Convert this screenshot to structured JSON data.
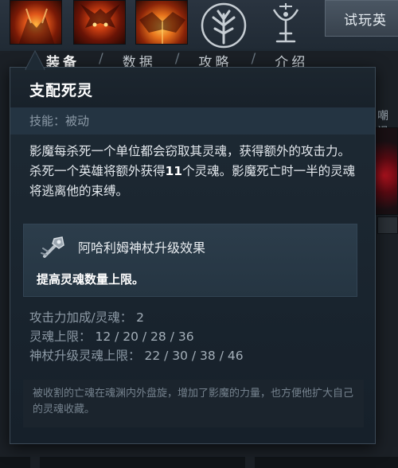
{
  "header": {
    "try_button_label": "试玩英"
  },
  "tabs": [
    {
      "label": "装备"
    },
    {
      "label": "数据"
    },
    {
      "label": "攻略"
    },
    {
      "label": "介绍"
    }
  ],
  "side": {
    "partial_text": "嘲讽"
  },
  "tooltip": {
    "ability_name": "支配死灵",
    "ability_type": "技能：被动",
    "description_part1": "影魔每杀死一个单位都会窃取其灵魂，获得额外的攻击力。杀死一个英雄将额外获得",
    "description_highlight": "11",
    "description_part2": "个灵魂。影魔死亡时一半的灵魂将逃离他的束缚。",
    "scepter_title": "阿哈利姆神杖升级效果",
    "scepter_description": "提高灵魂数量上限。",
    "stats": [
      {
        "label": "攻击力加成/灵魂：",
        "value": "2"
      },
      {
        "label": "灵魂上限：",
        "value": "12 / 20 / 28 / 36"
      },
      {
        "label": "神杖升级灵魂上限：",
        "value": "22 / 30 / 38 / 46"
      }
    ],
    "lore": "被收割的亡魂在魂渊内外盘旋，增加了影魔的力量，也方便他扩大自己的灵魂收藏。"
  },
  "icons": {
    "hero_portraits": [
      "hero-portrait-icon",
      "hero-portrait-icon",
      "hero-portrait-icon"
    ],
    "talent_tree": "talent-tree-icon",
    "talent_chalice": "talent-chalice-icon",
    "scepter": "aghanims-scepter-icon",
    "caret": "tooltip-caret-icon"
  },
  "colors": {
    "background": "#1b2026",
    "tooltip_bg": "#1e2a34",
    "type_band": "#243442",
    "scepter_box": "#2c3d4b",
    "text_primary": "#e4e9ee",
    "text_muted": "#8d9aa6"
  }
}
